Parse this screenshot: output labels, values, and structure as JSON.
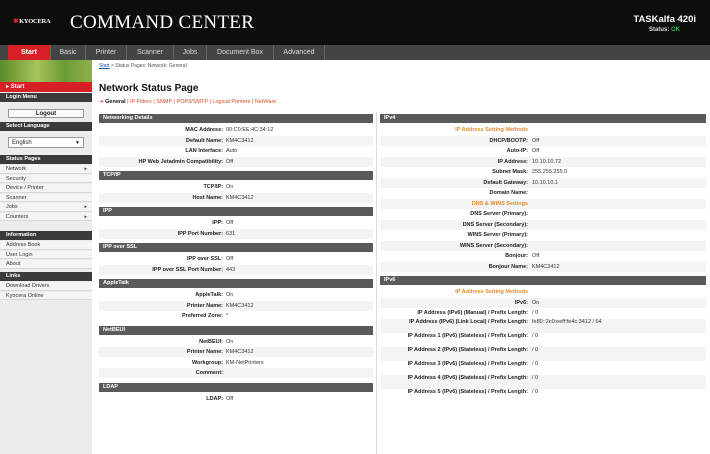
{
  "header": {
    "logo_text": "KYOCERA",
    "app_title": "COMMAND CENTER",
    "model": "TASKalfa 420i",
    "status_label": "Status:",
    "status_value": "OK"
  },
  "tabs": [
    "Start",
    "Basic",
    "Printer",
    "Scanner",
    "Jobs",
    "Document Box",
    "Advanced"
  ],
  "sidebar": {
    "start_label": "Start",
    "login_menu_label": "Login Menu",
    "logout_label": "Logout",
    "select_language_label": "Select Language",
    "language_value": "English",
    "status_pages_label": "Status Pages",
    "status_items": [
      {
        "label": "Network",
        "arrow": "▸"
      },
      {
        "label": "Security",
        "arrow": ""
      },
      {
        "label": "Device / Printer",
        "arrow": ""
      },
      {
        "label": "Scanner",
        "arrow": ""
      },
      {
        "label": "Jobs",
        "arrow": "▸"
      },
      {
        "label": "Counters",
        "arrow": "▸"
      }
    ],
    "information_label": "Information",
    "info_items": [
      "Address Book",
      "User Login",
      "About"
    ],
    "links_label": "Links",
    "link_items": [
      "Download Drivers",
      "Kyocera Online"
    ]
  },
  "breadcrumb": {
    "start": "Start",
    "rest": " > Status Pages: Network: General"
  },
  "page_title": "Network Status Page",
  "subtabs": [
    "General",
    "IP Filters",
    "SNMP",
    "POP3/SMTP",
    "Logical Printers",
    "NetWare"
  ],
  "left_sections": [
    {
      "title": "Networking Details",
      "rows": [
        {
          "label": "MAC Address:",
          "value": "00:C0:EE:4C:34:12"
        },
        {
          "label": "Default Name:",
          "value": "KM4C3412"
        },
        {
          "label": "LAN Interface:",
          "value": "Auto"
        },
        {
          "label": "HP Web Jetadmin Compatibility:",
          "value": "Off"
        }
      ]
    },
    {
      "title": "TCP/IP",
      "rows": [
        {
          "label": "TCP/IP:",
          "value": "On"
        },
        {
          "label": "Host Name:",
          "value": "KM4C3412"
        }
      ]
    },
    {
      "title": "IPP",
      "rows": [
        {
          "label": "IPP:",
          "value": "Off"
        },
        {
          "label": "IPP Port Number:",
          "value": "631"
        }
      ]
    },
    {
      "title": "IPP over SSL",
      "rows": [
        {
          "label": "IPP over SSL:",
          "value": "Off"
        },
        {
          "label": "IPP over SSL Port Number:",
          "value": "443"
        }
      ]
    },
    {
      "title": "AppleTalk",
      "rows": [
        {
          "label": "AppleTalk:",
          "value": "On"
        },
        {
          "label": "Printer Name:",
          "value": "KM4C3412"
        },
        {
          "label": "Preferred Zone:",
          "value": "*"
        }
      ]
    },
    {
      "title": "NetBEUI",
      "rows": [
        {
          "label": "NetBEUI:",
          "value": "On"
        },
        {
          "label": "Printer Name:",
          "value": "KM4C3412"
        },
        {
          "label": "Workgroup:",
          "value": "KM-NetPrinters"
        },
        {
          "label": "Comment:",
          "value": ""
        }
      ]
    },
    {
      "title": "LDAP",
      "rows": [
        {
          "label": "LDAP:",
          "value": "Off"
        }
      ]
    }
  ],
  "right_sections": [
    {
      "title": "IPv4",
      "rows": [
        {
          "sub": "IP Address Setting Methods"
        },
        {
          "label": "DHCP/BOOTP:",
          "value": "Off"
        },
        {
          "label": "Auto-IP:",
          "value": "Off"
        },
        {
          "label": "IP Address:",
          "value": "10.10.10.72"
        },
        {
          "label": "Subnet Mask:",
          "value": "255.255.255.0"
        },
        {
          "label": "Default Gateway:",
          "value": "10.10.10.1"
        },
        {
          "label": "Domain Name:",
          "value": ""
        },
        {
          "sub": "DNS & WINS Settings"
        },
        {
          "label": "DNS Server (Primary):",
          "value": ""
        },
        {
          "label": "DNS Server (Secondary):",
          "value": ""
        },
        {
          "label": "WINS Server (Primary):",
          "value": ""
        },
        {
          "label": "WINS Server (Secondary):",
          "value": ""
        },
        {
          "label": "Bonjour:",
          "value": "Off"
        },
        {
          "label": "Bonjour Name:",
          "value": "KM4C3412"
        }
      ]
    },
    {
      "title": "IPv6",
      "rows": [
        {
          "sub": "IP Address Setting Methods"
        },
        {
          "label": "IPv6:",
          "value": "On"
        },
        {
          "label": "IP Address (IPv6) (Manual) / Prefix Length:",
          "value": "/ 0"
        },
        {
          "label": "IP Address (IPv6) (Link Local) / Prefix Length:",
          "value": "fe80::2c0:eeff:fe4c:3412 / 64",
          "two": true
        },
        {
          "label": "IP Address 1 (IPv6) (Stateless) / Prefix Length:",
          "value": "/ 0",
          "two": true
        },
        {
          "label": "IP Address 2 (IPv6) (Stateless) / Prefix Length:",
          "value": "/ 0",
          "two": true
        },
        {
          "label": "IP Address 3 (IPv6) (Stateless) / Prefix Length:",
          "value": "/ 0",
          "two": true
        },
        {
          "label": "IP Address 4 (IPv6) (Stateless) / Prefix Length:",
          "value": "/ 0",
          "two": true
        },
        {
          "label": "IP Address 5 (IPv6) (Stateless) / Prefix Length:",
          "value": "/ 0",
          "two": true
        }
      ]
    }
  ],
  "colors": {
    "accent": "#d71f26",
    "header": "#0d0d0d",
    "section": "#5a5a5a",
    "sub_heading": "#e58a2a"
  }
}
